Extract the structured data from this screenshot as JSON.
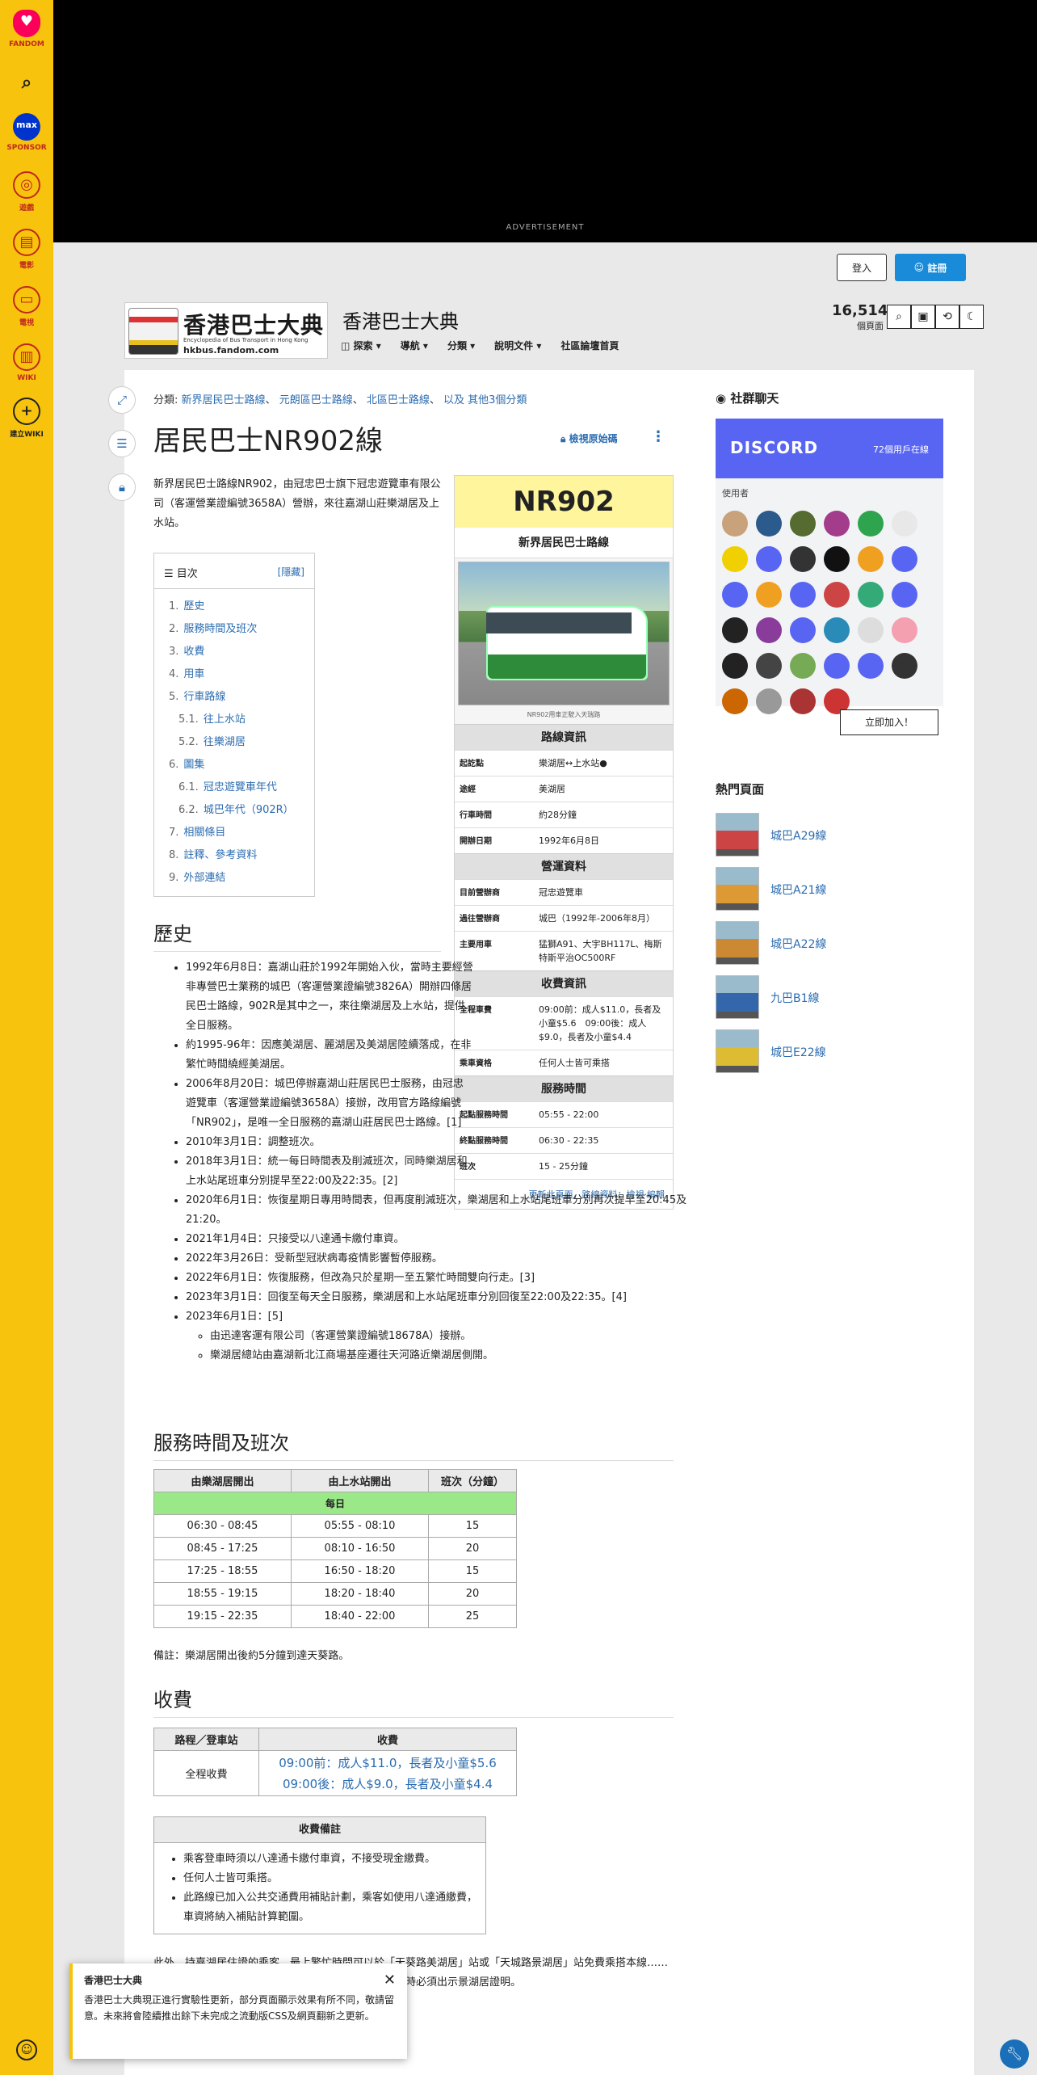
{
  "rail": {
    "items": [
      {
        "icon": "fandom-icon",
        "label": "FANDOM"
      },
      {
        "icon": "search-icon",
        "label": ""
      },
      {
        "icon": "max-icon",
        "label": "SPONSOR"
      },
      {
        "icon": "games-icon",
        "label": "遊戲"
      },
      {
        "icon": "movies-icon",
        "label": "電影"
      },
      {
        "icon": "tv-icon",
        "label": "電視"
      },
      {
        "icon": "wiki-icon",
        "label": "WIKI"
      },
      {
        "icon": "plus-icon",
        "label": "建立WIKI"
      }
    ]
  },
  "ad": {
    "label": "ADVERTISEMENT"
  },
  "header": {
    "login": "登入",
    "register": "註冊",
    "logo": {
      "title": "香港巴士大典",
      "subtitle": "Encyclopedia of Bus Transport in Hong Kong",
      "domain": "hkbus.fandom.com"
    },
    "site_title": "香港巴士大典",
    "nav": [
      "探索",
      "導航",
      "分類",
      "說明文件",
      "社區論壇首頁"
    ],
    "stats": {
      "count": "16,514",
      "label": "個頁面"
    }
  },
  "page": {
    "categories_label": "分類:",
    "categories": [
      "新界居民巴士路線",
      "元朗區巴士路線",
      "北區巴士路線"
    ],
    "categories_more": "以及 其他3個分類",
    "title": "居民巴士NR902線",
    "view_source": "檢視原始碼",
    "intro": "新界居民巴士路線NR902，由冠忠巴士旗下冠忠遊覽車有限公司（客運營業證編號3658A）營辦，來往嘉湖山莊樂湖居及上水站。",
    "toc": {
      "title": "目次",
      "hide": "[隱藏]",
      "items": [
        {
          "n": "1.",
          "t": "歷史",
          "sub": false
        },
        {
          "n": "2.",
          "t": "服務時間及班次",
          "sub": false
        },
        {
          "n": "3.",
          "t": "收費",
          "sub": false
        },
        {
          "n": "4.",
          "t": "用車",
          "sub": false
        },
        {
          "n": "5.",
          "t": "行車路線",
          "sub": false
        },
        {
          "n": "5.1.",
          "t": "往上水站",
          "sub": true
        },
        {
          "n": "5.2.",
          "t": "往樂湖居",
          "sub": true
        },
        {
          "n": "6.",
          "t": "圖集",
          "sub": false
        },
        {
          "n": "6.1.",
          "t": "冠忠遊覽車年代",
          "sub": true
        },
        {
          "n": "6.2.",
          "t": "城巴年代（902R）",
          "sub": true
        },
        {
          "n": "7.",
          "t": "相關條目",
          "sub": false
        },
        {
          "n": "8.",
          "t": "註釋、參考資料",
          "sub": false
        },
        {
          "n": "9.",
          "t": "外部連結",
          "sub": false
        }
      ]
    }
  },
  "infobox": {
    "code": "NR902",
    "route_type": "新界居民巴士路線",
    "caption": "NR902用車正駛入天瑞路",
    "sec1": "路線資訊",
    "rows1": [
      {
        "k": "起訖點",
        "v": "樂湖居↔上水站●"
      },
      {
        "k": "途經",
        "v": "美湖居"
      },
      {
        "k": "行車時間",
        "v": "約28分鐘"
      },
      {
        "k": "開辦日期",
        "v": "1992年6月8日"
      }
    ],
    "sec2": "營運資料",
    "rows2": [
      {
        "k": "目前營辦商",
        "v": "冠忠遊覽車"
      },
      {
        "k": "過往營辦商",
        "v": "城巴（1992年-2006年8月）"
      },
      {
        "k": "主要用車",
        "v": "猛獅A91、大宇BH117L、梅斯特斯平治OC500RF"
      }
    ],
    "sec3": "收費資訊",
    "rows3": [
      {
        "k": "全程車費",
        "v": "09:00前：成人$11.0，長者及小童$5.6　09:00後：成人$9.0，長者及小童$4.4"
      },
      {
        "k": "乘車資格",
        "v": "任何人士皆可乘搭"
      }
    ],
    "sec4": "服務時間",
    "rows4": [
      {
        "k": "起點服務時間",
        "v": "05:55 - 22:00"
      },
      {
        "k": "終點服務時間",
        "v": "06:30 - 22:35"
      },
      {
        "k": "班次",
        "v": "15 - 25分鐘"
      }
    ],
    "footer": "更新此頁面，路線資料：檢視·編輯"
  },
  "history": {
    "heading": "歷史",
    "items": [
      "1992年6月8日：嘉湖山莊於1992年開始入伙，當時主要經營非專營巴士業務的城巴（客運營業證編號3826A）開辦四條居民巴士路線，902R是其中之一，來往樂湖居及上水站，提供全日服務。",
      "約1995-96年：因應美湖居、麗湖居及美湖居陸續落成，在非繁忙時間繞經美湖居。",
      "2006年8月20日：城巴停辦嘉湖山莊居民巴士服務，由冠忠遊覽車（客運營業證編號3658A）接辦，改用官方路線編號「NR902」，是唯一全日服務的嘉湖山莊居民巴士路線。[1]",
      "2010年3月1日：調整班次。",
      "2018年3月1日：統一每日時間表及削減班次，同時樂湖居和上水站尾班車分別提早至22:00及22:35。[2]",
      "2020年6月1日：恢復星期日專用時間表，但再度削減班次，樂湖居和上水站尾班車分別再次提早至20:45及21:20。",
      "2021年1月4日：只接受以八達通卡繳付車資。",
      "2022年3月26日：受新型冠狀病毒疫情影響暫停服務。",
      "2022年6月1日：恢復服務，但改為只於星期一至五繁忙時間雙向行走。[3]",
      "2023年3月1日：回復至每天全日服務，樂湖居和上水站尾班車分別回復至22:00及22:35。[4]",
      "2023年6月1日：[5]"
    ],
    "subitems": [
      "由迅達客運有限公司（客運營業證編號18678A）接辦。",
      "樂湖居總站由嘉湖新北江商場基座遷往天河路近樂湖居側開。"
    ]
  },
  "schedule": {
    "heading": "服務時間及班次",
    "cols": [
      "由樂湖居開出",
      "由上水站開出",
      "班次（分鐘）"
    ],
    "daily": "每日",
    "rows": [
      [
        "06:30 - 08:45",
        "05:55 - 08:10",
        "15"
      ],
      [
        "08:45 - 17:25",
        "08:10 - 16:50",
        "20"
      ],
      [
        "17:25 - 18:55",
        "16:50 - 18:20",
        "15"
      ],
      [
        "18:55 - 19:15",
        "18:20 - 18:40",
        "20"
      ],
      [
        "19:15 - 22:35",
        "18:40 - 22:00",
        "25"
      ]
    ],
    "note": "備註：樂湖居開出後約5分鐘到達天葵路。"
  },
  "fares": {
    "heading": "收費",
    "cols": [
      "路程／登車站",
      "收費"
    ],
    "row_label": "全程收費",
    "fare1": "09:00前：成人$11.0，長者及小童$5.6",
    "fare2": "09:00後：成人$9.0，長者及小童$4.4",
    "notes_title": "收費備註",
    "notes": [
      "乘客登車時須以八達通卡繳付車資，不接受現金繳費。",
      "任何人士皆可乘搭。",
      "此路線已加入公共交通費用補貼計劃，乘客如使用八達通繳費，車資將納入補貼計算範圍。"
    ],
    "bottom": "此外，持嘉湖居住證的乘客，最上繁忙時間可以於「天葵路美湖居」站或「天城路景湖居」站免費乘搭本線……前往上水站轉乘接駁服務。使用此免費服務的乘客登車時必須出示景湖居證明。"
  },
  "toast": {
    "title": "香港巴士大典",
    "body": "香港巴士大典現正進行實驗性更新，部分頁面顯示效果有所不同，敬請留意。未來將會陸續推出餘下未完成之流動版CSS及網頁翻新之更新。"
  },
  "sidebar": {
    "chat_title": "社群聊天",
    "discord": "DISCORD",
    "online": "72個用戶在線",
    "users_label": "使用者",
    "join": "立即加入！",
    "hot_title": "熱門頁面",
    "hot": [
      "城巴A29線",
      "城巴A21線",
      "城巴A22線",
      "九巴B1線",
      "城巴E22線"
    ],
    "avatar_colors": [
      "#c8a27a",
      "#2b5a8c",
      "#556b2f",
      "#a23c8b",
      "#2ea44f",
      "#e8e8e8",
      "#f0d000",
      "#5865f2",
      "#333",
      "#111",
      "#f0a020",
      "#5865f2",
      "#5865f2",
      "#f0a020",
      "#5865f2",
      "#c44",
      "#3a7",
      "#5865f2",
      "#222",
      "#8a3c9a",
      "#5865f2",
      "#2a8ab8",
      "#ddd",
      "#f4a0b0",
      "#222",
      "#444",
      "#7a5",
      "#5865f2",
      "#5865f2",
      "#333",
      "#c60",
      "#999",
      "#a33",
      "#c33"
    ]
  }
}
